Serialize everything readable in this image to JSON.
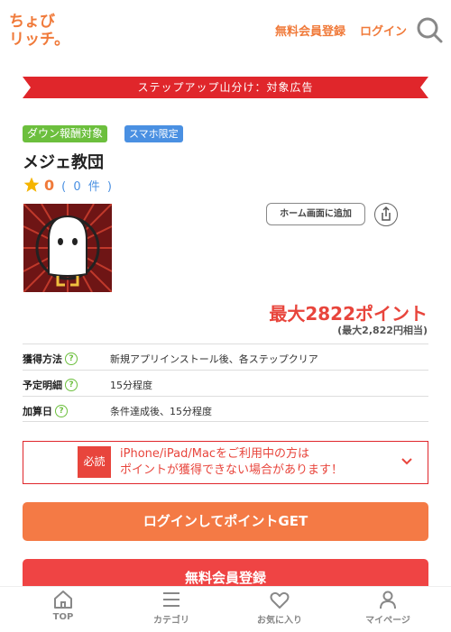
{
  "header": {
    "logo_text": "ちょびリッチ。",
    "register_link": "無料会員登録",
    "login_link": "ログイン"
  },
  "banner": "ステップアップ山分け：対象広告",
  "tags": [
    "ダウン報酬対象",
    "スマホ限定"
  ],
  "app": {
    "title": "メジェ教団",
    "rating": "0",
    "review_count": "( 0 件 )",
    "home_button": "ホーム画面に追加"
  },
  "points": {
    "main": "最大2822ポイント",
    "sub": "(最大2,822円相当)"
  },
  "details": [
    {
      "key": "獲得方法",
      "value": "新規アプリインストール後、各ステップクリア"
    },
    {
      "key": "予定明細",
      "value": "15分程度"
    },
    {
      "key": "加算日",
      "value": "条件達成後、15分程度"
    }
  ],
  "notice": {
    "badge": "必読",
    "line1": "iPhone/iPad/Macをご利用中の方は",
    "line2": "ポイントが獲得できない場合があります！"
  },
  "buttons": {
    "login": "ログインしてポイントGET",
    "register": "無料会員登録"
  },
  "tabbar": [
    "TOP",
    "カテゴリ",
    "お気に入り",
    "マイページ"
  ],
  "colors": {
    "accent": "#f07a3a",
    "banner_red": "#e0262b",
    "login_button": "#f47a45",
    "register_button": "#ef4444"
  }
}
